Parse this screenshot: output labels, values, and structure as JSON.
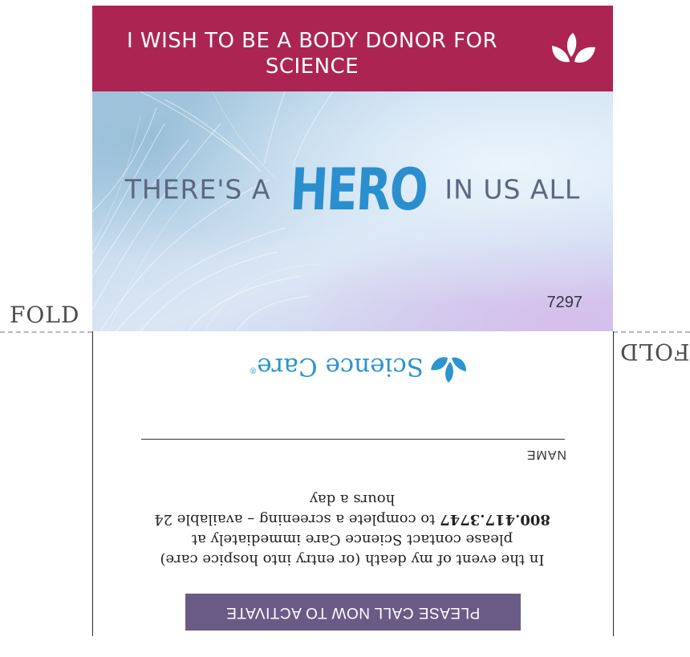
{
  "banner": {
    "title": "I WISH TO BE A BODY DONOR FOR SCIENCE"
  },
  "hero": {
    "pre": "THERE'S A",
    "word": "HERO",
    "post": "IN US ALL"
  },
  "card_code": "7297",
  "fold": {
    "left": "FOLD",
    "right": "FOLD"
  },
  "back": {
    "activate": "PLEASE CALL NOW TO ACTIVATE",
    "instructions": {
      "line1": "In the event of my death (or entry into hospice care)",
      "line2": "please contact Science Care immediately at",
      "phone": "800.417.3747",
      "line3_rest": " to complete a screening – available 24",
      "line4": "hours a day"
    },
    "name_label": "NAME",
    "logo_text": "Science Care",
    "logo_mark": "®"
  },
  "colors": {
    "banner": "#ac2552",
    "hero_word": "#2b8fcf",
    "activate_box": "#6a5b86",
    "logo": "#2c95cf"
  },
  "icons": {
    "banner_logo": "leaf-icon",
    "science_care_logo": "leaf-icon"
  }
}
